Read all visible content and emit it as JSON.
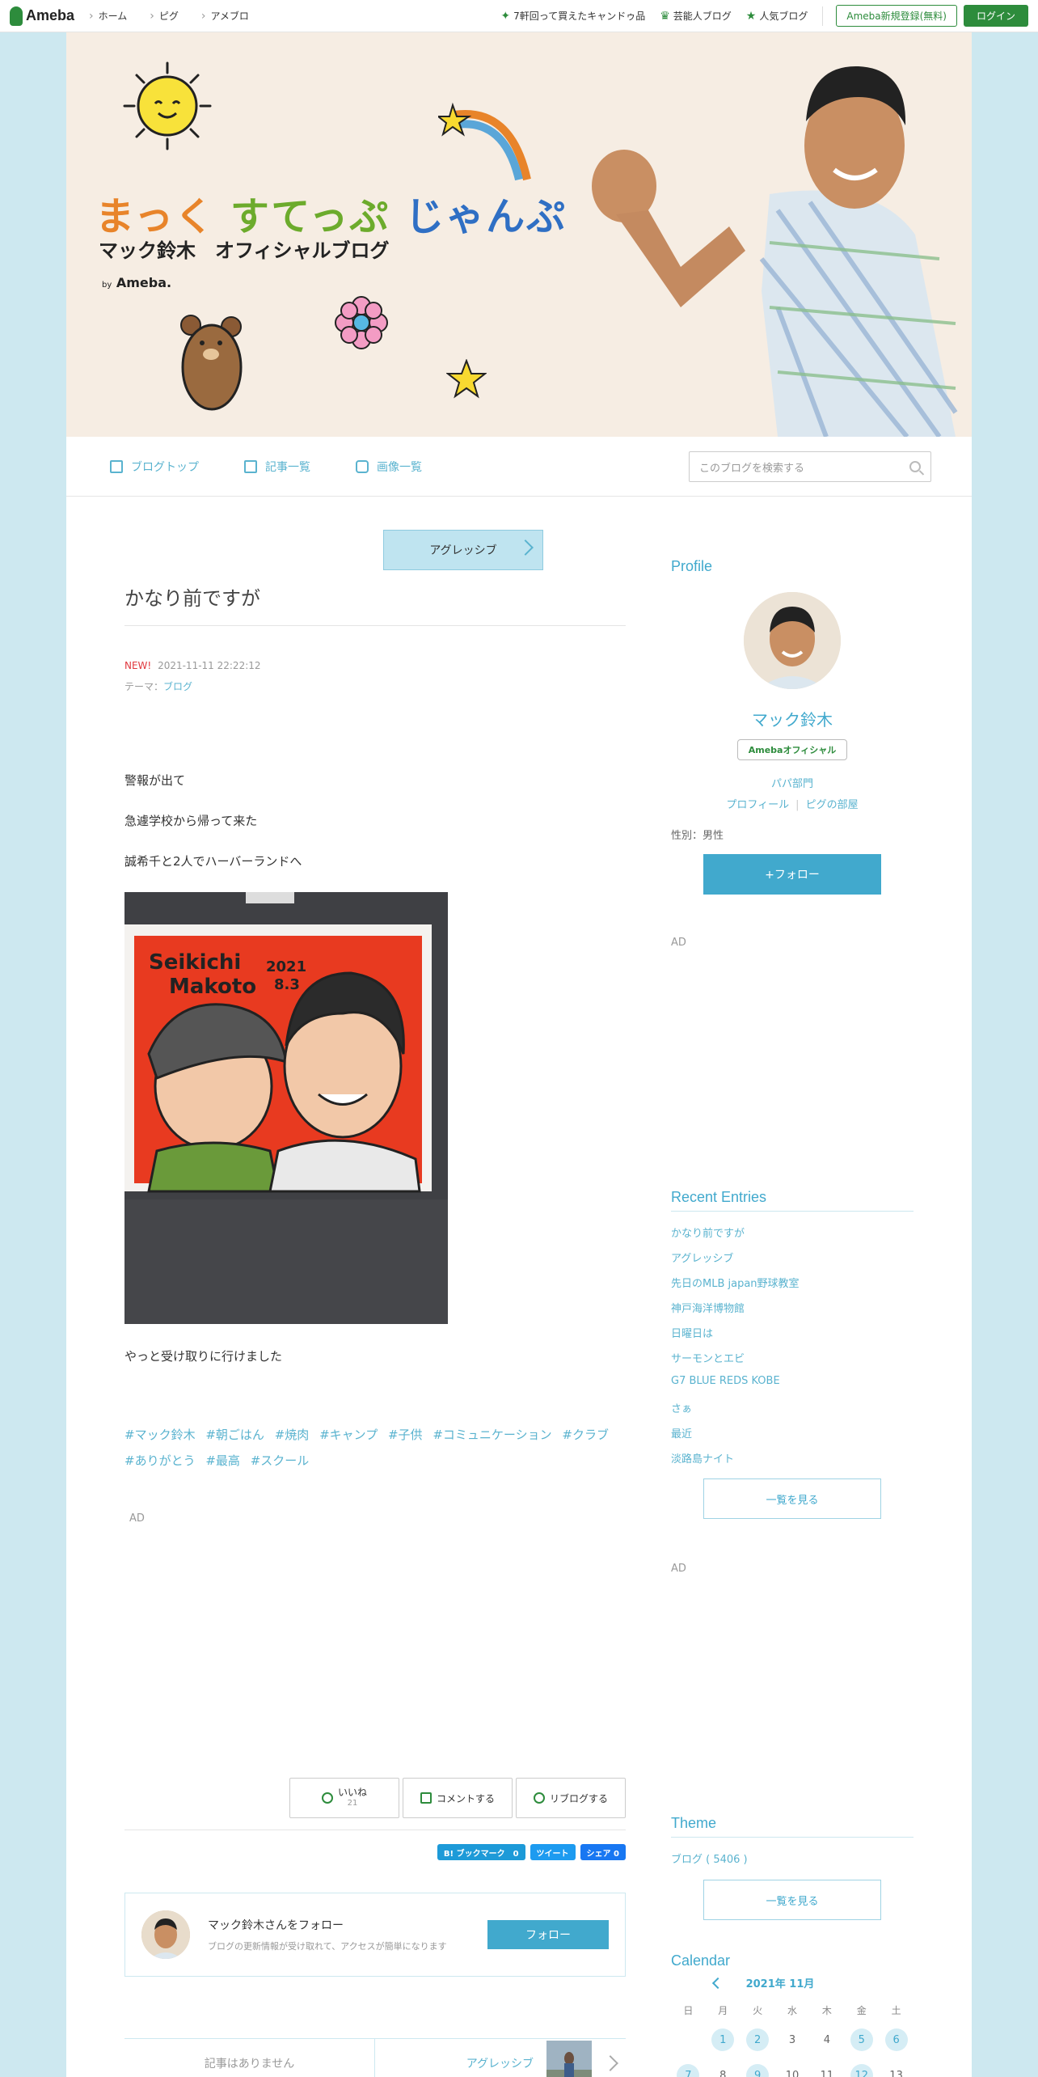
{
  "topbar": {
    "logo": "Ameba",
    "nav": [
      "ホーム",
      "ピグ",
      "アメブロ"
    ],
    "right_links": [
      "7軒回って買えたキャンドゥ品",
      "芸能人ブログ",
      "人気ブログ"
    ],
    "register": "Ameba新規登録(無料)",
    "login": "ログイン"
  },
  "banner": {
    "title_part1": "まっく",
    "title_part2": "すてっぷ",
    "title_part3": "じゃんぷ",
    "subtitle": "マック鈴木　オフィシャルブログ",
    "by": "by",
    "brand": "Ameba."
  },
  "blognav": {
    "items": [
      "ブログトップ",
      "記事一覧",
      "画像一覧"
    ],
    "search_placeholder": "このブログを検索する"
  },
  "post": {
    "prev_title": "アグレッシブ",
    "title": "かなり前ですが",
    "new_label": "NEW!",
    "datetime": "2021-11-11 22:22:12",
    "theme_label": "テーマ：",
    "theme_value": "ブログ",
    "lines": [
      "警報が出て",
      "急遽学校から帰って来た",
      "誠希千と2人でハーバーランドへ"
    ],
    "after_photo": "やっと受け取りに行けました",
    "photo_caption1": "Seikichi",
    "photo_caption2": "Makoto",
    "photo_year": "2021",
    "photo_date": "8.3",
    "hashtags": [
      "#マック鈴木",
      "#朝ごはん",
      "#焼肉",
      "#キャンプ",
      "#子供",
      "#コミュニケーション",
      "#クラブ",
      "#ありがとう",
      "#最高",
      "#スクール"
    ],
    "ad": "AD"
  },
  "actions": {
    "like": "いいね",
    "like_count": "21",
    "comment": "コメントする",
    "reblog": "リブログする"
  },
  "shares": {
    "hatena": "B! ブックマーク　0",
    "tweet": "ツイート",
    "facebook": "シェア 0"
  },
  "follow_box": {
    "title": "マック鈴木さんをフォロー",
    "desc": "ブログの更新情報が受け取れて、アクセスが簡単になります",
    "button": "フォロー"
  },
  "pager": {
    "prev": "記事はありません",
    "next": "アグレッシブ"
  },
  "sidebar": {
    "profile_title": "Profile",
    "name": "マック鈴木",
    "official": "Amebaオフィシャル",
    "dept": "パパ部門",
    "profile_link": "プロフィール",
    "pig_link": "ピグの部屋",
    "gender": "性別：男性",
    "follow": "+フォロー",
    "ad1": "AD",
    "recent_title": "Recent Entries",
    "recent": [
      "かなり前ですが",
      "アグレッシブ",
      "先日のMLB japan野球教室",
      "神戸海洋博物館",
      "日曜日は",
      "サーモンとエビ",
      "G7 BLUE REDS KOBE",
      "さぁ",
      "最近",
      "淡路島ナイト"
    ],
    "more": "一覧を見る",
    "ad2": "AD",
    "theme_title": "Theme",
    "theme_item": "ブログ ( 5406 )",
    "theme_more": "一覧を見る",
    "calendar_title": "Calendar",
    "calendar_month": "2021年 11月",
    "dow": [
      "日",
      "月",
      "火",
      "水",
      "木",
      "金",
      "土"
    ],
    "week1": [
      "",
      "1",
      "2",
      "3",
      "4",
      "5",
      "6"
    ],
    "week2": [
      "7",
      "8",
      "9",
      "10",
      "11",
      "12",
      "13"
    ]
  },
  "colors": {
    "accent": "#41a9cd",
    "ameba_green": "#2d8c3c",
    "page_bg": "#cde8f0"
  }
}
